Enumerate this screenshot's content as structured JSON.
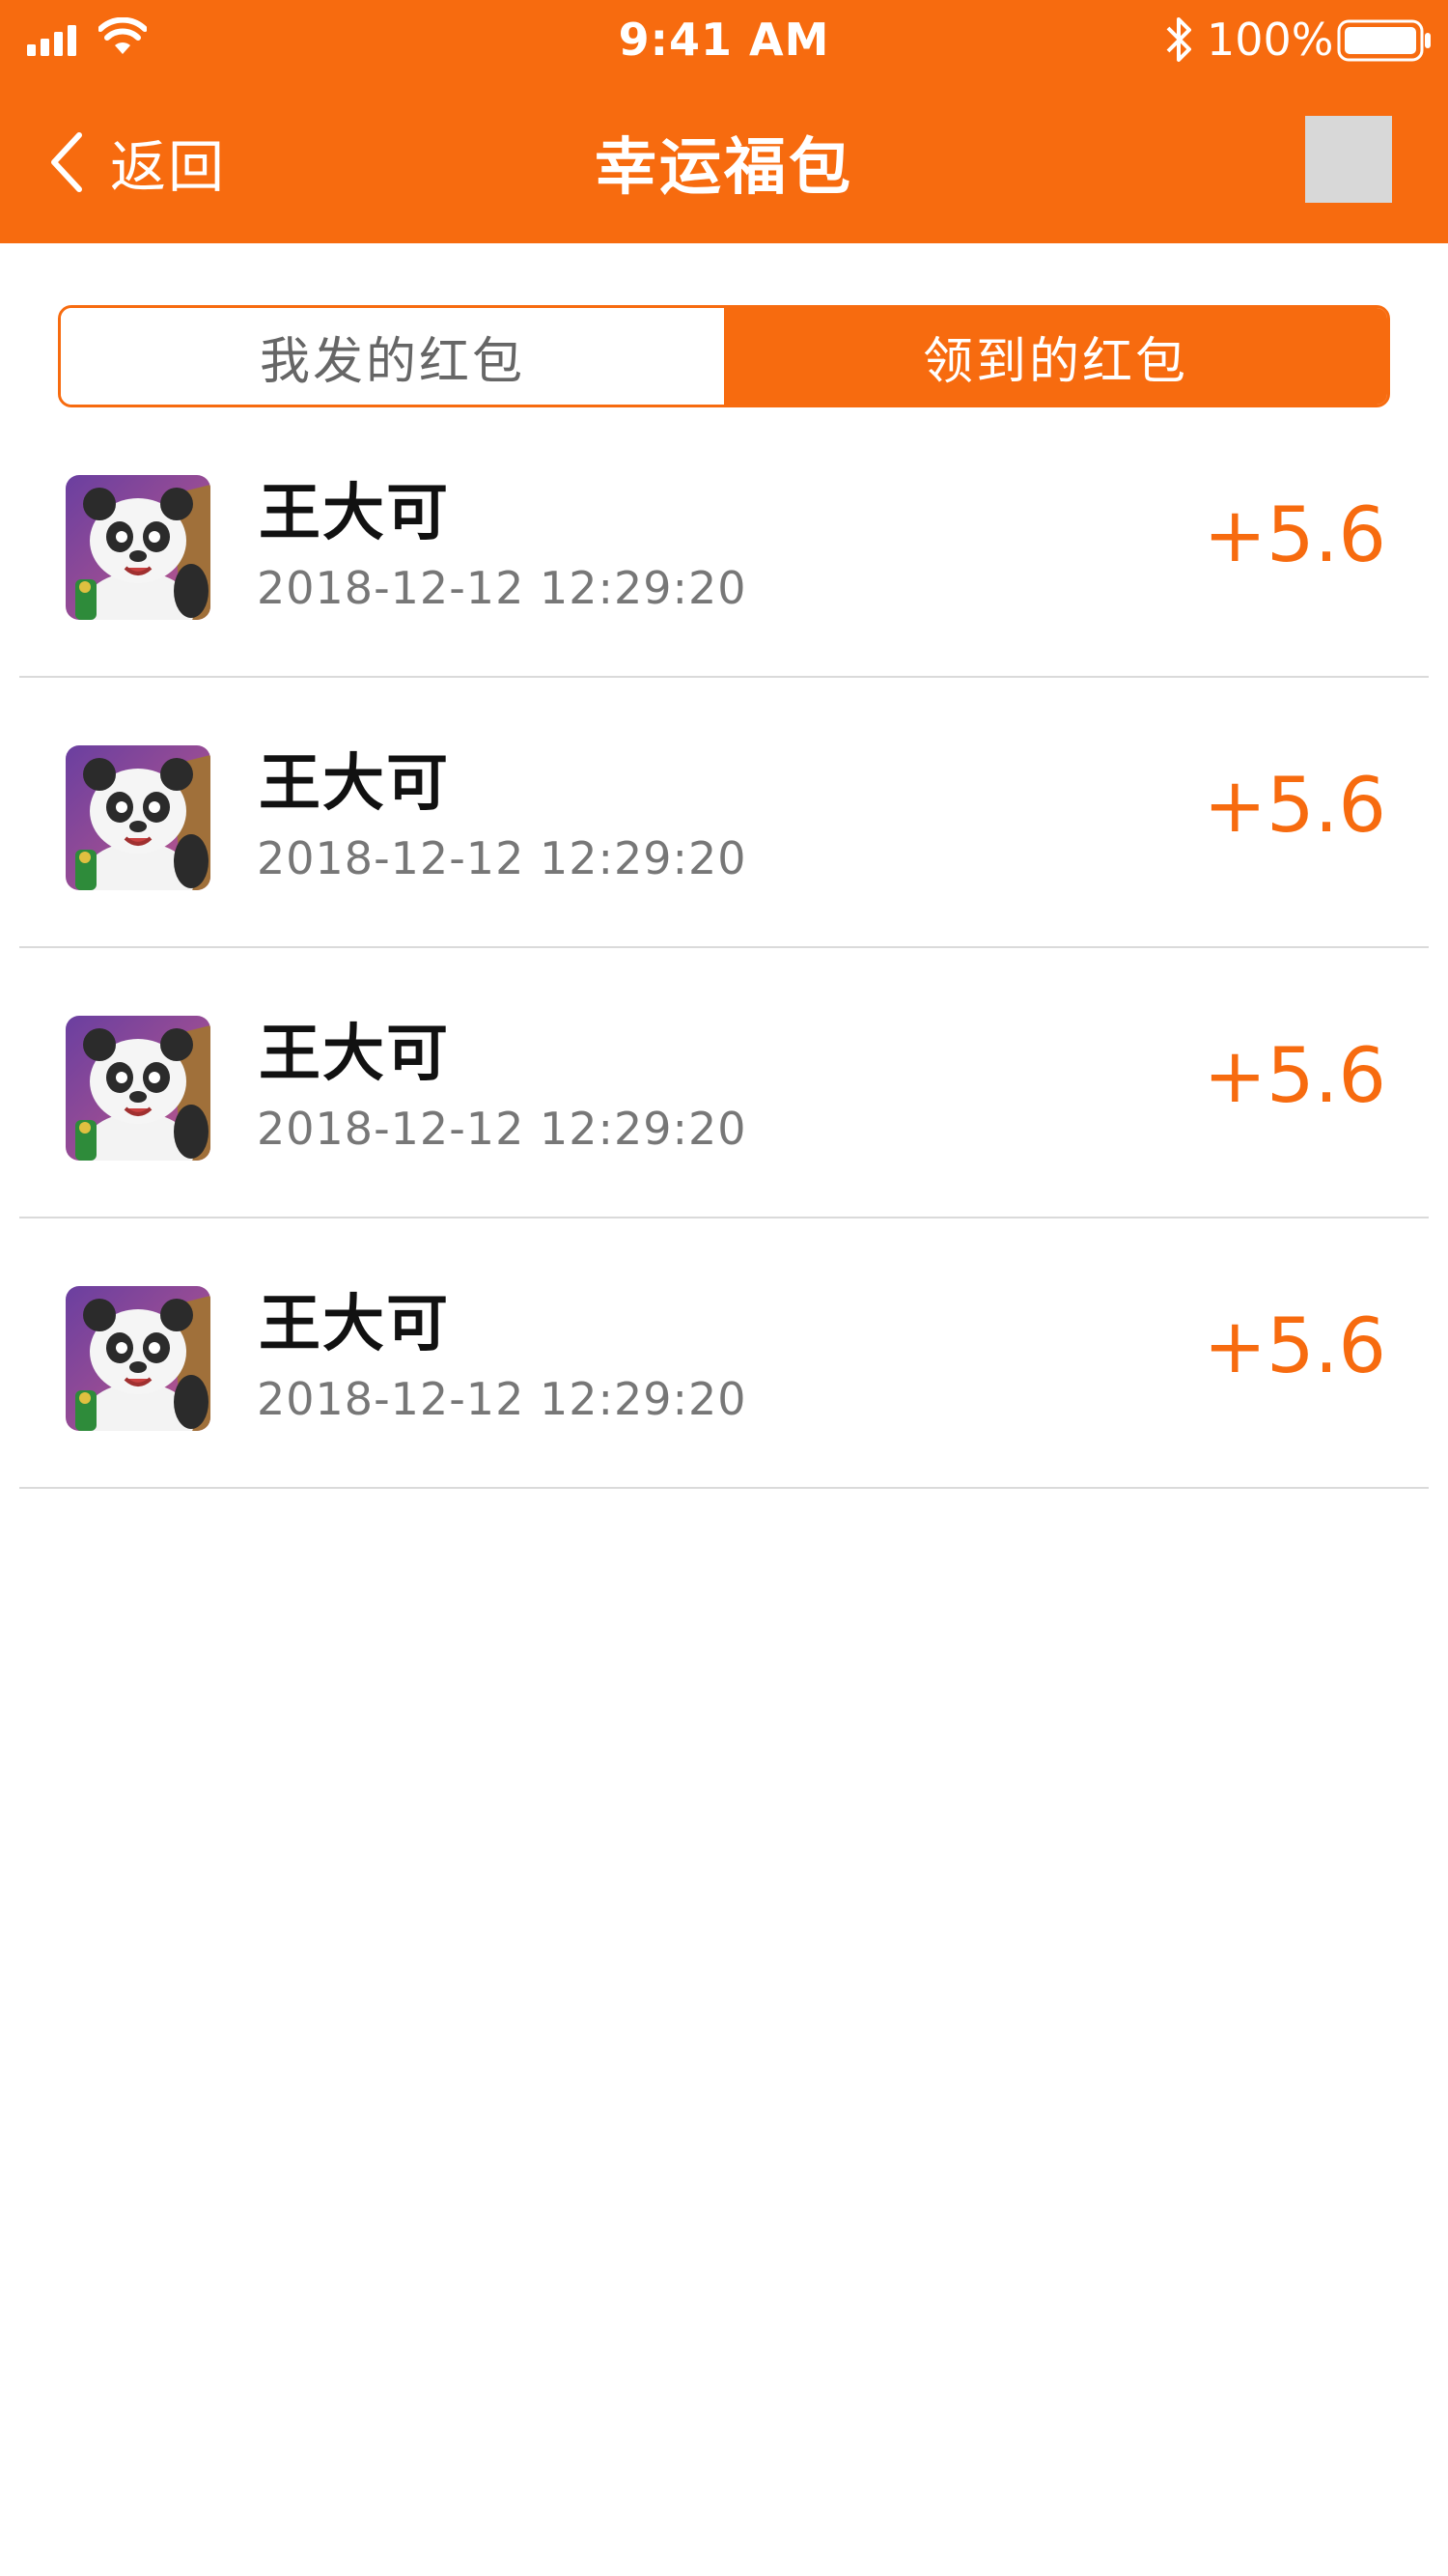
{
  "colors": {
    "accent": "#F76B0F",
    "background": "#FFFFFF",
    "divider": "#DADADA",
    "secondary_text": "#777777"
  },
  "status_bar": {
    "time": "9:41 AM",
    "battery_percent": "100%",
    "icons": [
      "signal-icon",
      "wifi-icon",
      "bluetooth-icon",
      "battery-icon"
    ]
  },
  "nav": {
    "back_label": "返回",
    "title": "幸运福包",
    "back_icon": "chevron-left-icon"
  },
  "tabs": [
    {
      "label": "我发的红包",
      "active": false
    },
    {
      "label": "领到的红包",
      "active": true
    }
  ],
  "list": {
    "items": [
      {
        "name": "王大可",
        "time": "2018-12-12 12:29:20",
        "amount": "+5.6"
      },
      {
        "name": "王大可",
        "time": "2018-12-12 12:29:20",
        "amount": "+5.6"
      },
      {
        "name": "王大可",
        "time": "2018-12-12 12:29:20",
        "amount": "+5.6"
      },
      {
        "name": "王大可",
        "time": "2018-12-12 12:29:20",
        "amount": "+5.6"
      }
    ]
  }
}
